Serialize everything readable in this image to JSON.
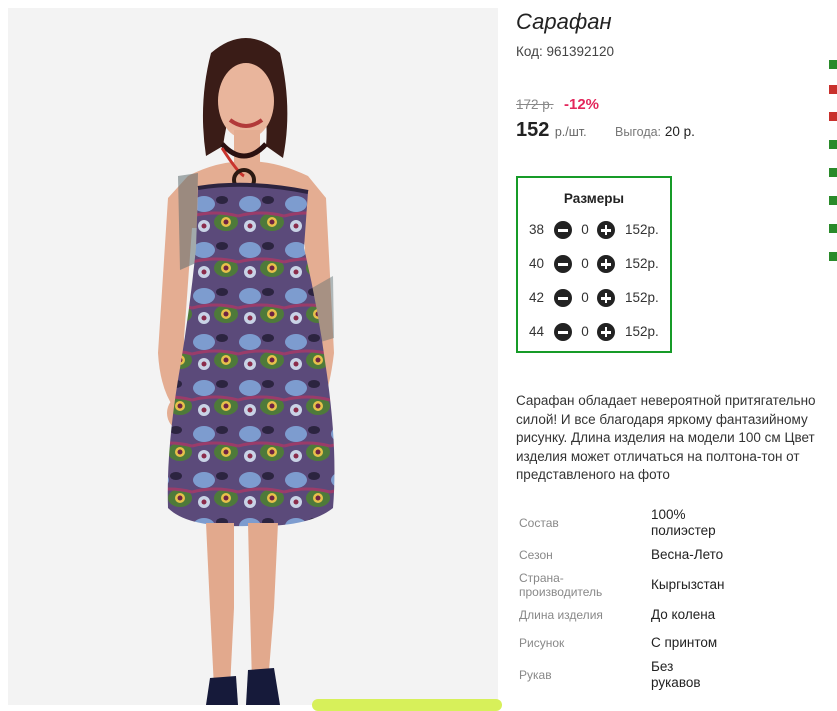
{
  "product": {
    "title": "Сарафан",
    "code_label": "Код:",
    "code_value": "961392120",
    "old_price": "172 р.",
    "discount": "-12%",
    "price": "152",
    "price_unit": "р./шт.",
    "savings_label": "Выгода:",
    "savings_value": "20 р."
  },
  "sizes": {
    "title": "Размеры",
    "rows": [
      {
        "size": "38",
        "qty": "0",
        "price": "152р."
      },
      {
        "size": "40",
        "qty": "0",
        "price": "152р."
      },
      {
        "size": "42",
        "qty": "0",
        "price": "152р."
      },
      {
        "size": "44",
        "qty": "0",
        "price": "152р."
      }
    ]
  },
  "description": [
    "Сарафан обладает невероятной притягательно",
    "силой! И все благодаря яркому фантазийному",
    "рисунку. Длина изделия на модели 100 см Цвет",
    "изделия может отличаться на полтона-тон от",
    "представленого на фото"
  ],
  "specs": [
    {
      "label": [
        "Состав"
      ],
      "value": [
        "100%",
        "полиэстер"
      ]
    },
    {
      "label": [
        "Сезон"
      ],
      "value": [
        "Весна-Лето"
      ]
    },
    {
      "label": [
        "Страна-",
        "производитель"
      ],
      "value": [
        "Кыргызстан"
      ]
    },
    {
      "label": [
        "Длина изделия"
      ],
      "value": [
        "До колена"
      ]
    },
    {
      "label": [
        "Рисунок"
      ],
      "value": [
        "С принтом"
      ]
    },
    {
      "label": [
        "Рукав"
      ],
      "value": [
        "Без",
        "рукавов"
      ]
    }
  ],
  "colors": {
    "accent_border": "#169b28",
    "discount": "#e3265b",
    "button_peek": "#d7f05a"
  },
  "icons": {
    "minus": "minus-circle-icon",
    "plus": "plus-circle-icon"
  }
}
